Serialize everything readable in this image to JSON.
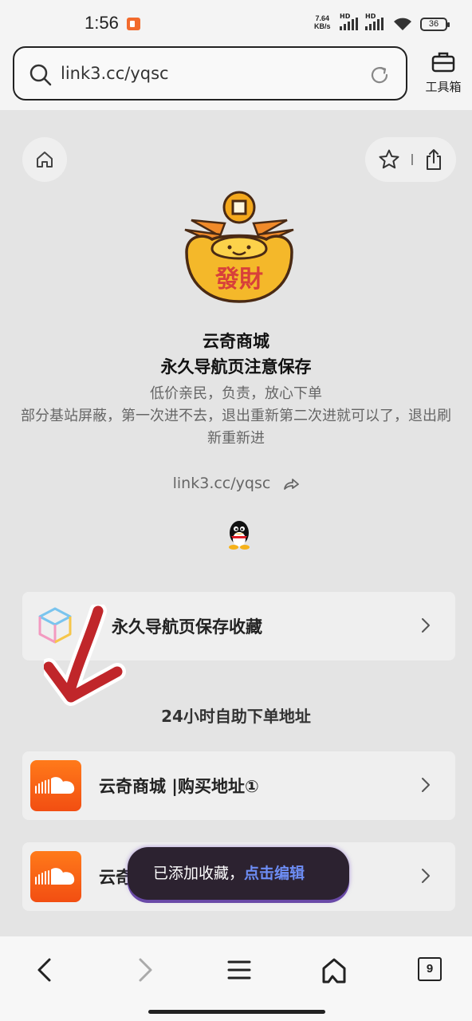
{
  "status_bar": {
    "time": "1:56",
    "net_speed_value": "7.64",
    "net_speed_unit": "KB/s",
    "sim1_label": "HD",
    "sim2_label": "HD",
    "battery": "36"
  },
  "address_bar": {
    "url": "link3.cc/yqsc",
    "toolbox_label": "工具箱"
  },
  "profile": {
    "logo_text": "發財",
    "title_line1": "云奇商城",
    "title_line2": "永久导航页注意保存",
    "description": "低价亲民，负责，放心下单\n部分基站屏蔽，第一次进不去，退出重新第二次进就可以了，退出刷新重新进",
    "link": "link3.cc/yqsc"
  },
  "links": [
    {
      "label": "永久导航页保存收藏",
      "icon": "cube-icon"
    },
    {
      "label": "云奇商城 |购买地址①",
      "icon": "soundcloud-icon"
    },
    {
      "label": "云奇商城 |购买地址②",
      "icon": "soundcloud-icon"
    }
  ],
  "section_title": "24小时自助下单地址",
  "toast": {
    "message": "已添加收藏，",
    "action": "点击编辑"
  },
  "tab_count": "9",
  "colors": {
    "background": "#e4e4e4",
    "card": "#efefef",
    "soundcloud_orange": "#f4561a",
    "toast_action": "#6d8df4",
    "annotation_arrow": "#c0262a"
  }
}
